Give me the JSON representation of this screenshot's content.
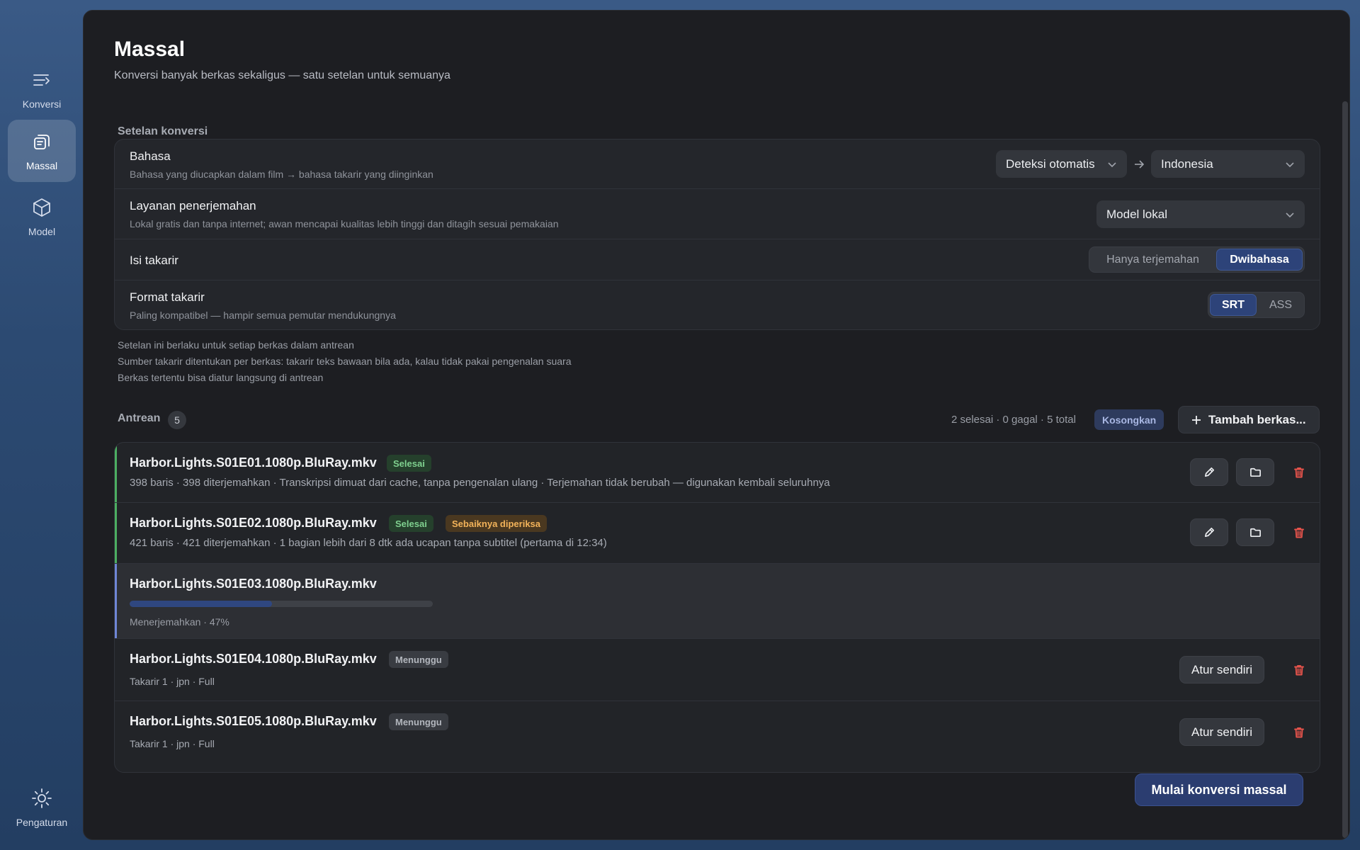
{
  "nav": {
    "items": [
      {
        "label": "Konversi",
        "icon": "convert-icon",
        "active": false
      },
      {
        "label": "Massal",
        "icon": "batch-icon",
        "active": true
      },
      {
        "label": "Model",
        "icon": "cube-icon",
        "active": false
      }
    ],
    "settings_label": "Pengaturan"
  },
  "page": {
    "title": "Massal",
    "subtitle": "Konversi banyak berkas sekaligus — satu setelan untuk semuanya"
  },
  "settings": {
    "section_label": "Setelan konversi",
    "language": {
      "title": "Bahasa",
      "desc": "Bahasa yang diucapkan dalam film → bahasa takarir yang diinginkan",
      "source": "Deteksi otomatis",
      "target": "Indonesia"
    },
    "service": {
      "title": "Layanan penerjemahan",
      "desc": "Lokal gratis dan tanpa internet; awan mencapai kualitas lebih tinggi dan ditagih sesuai pemakaian",
      "value": "Model lokal"
    },
    "content": {
      "title": "Isi takarir",
      "options": [
        "Hanya terjemahan",
        "Dwibahasa"
      ],
      "selected": "Dwibahasa"
    },
    "format": {
      "title": "Format takarir",
      "desc": "Paling kompatibel — hampir semua pemutar mendukungnya",
      "options": [
        "SRT",
        "ASS"
      ],
      "selected": "SRT"
    },
    "notes": [
      "Setelan ini berlaku untuk setiap berkas dalam antrean",
      "Sumber takarir ditentukan per berkas: takarir teks bawaan bila ada, kalau tidak pakai pengenalan suara",
      "Berkas tertentu bisa diatur langsung di antrean"
    ]
  },
  "queue": {
    "label": "Antrean",
    "count": "5",
    "stats": "2 selesai · 0 gagal · 5 total",
    "clear_label": "Kosongkan",
    "add_label": "Tambah berkas...",
    "items": [
      {
        "name": "Harbor.Lights.S01E01.1080p.BluRay.mkv",
        "tags": [
          "Selesai"
        ],
        "detail": "398 baris · 398 diterjemahkan · Transkripsi dimuat dari cache, tanpa pengenalan ulang · Terjemahan tidak berubah — digunakan kembali seluruhnya",
        "status": "done"
      },
      {
        "name": "Harbor.Lights.S01E02.1080p.BluRay.mkv",
        "tags": [
          "Selesai",
          "Sebaiknya diperiksa"
        ],
        "detail": "421 baris · 421 diterjemahkan · 1 bagian lebih dari 8 dtk ada ucapan tanpa subtitel (pertama di 12:34)",
        "status": "done"
      },
      {
        "name": "Harbor.Lights.S01E03.1080p.BluRay.mkv",
        "detail": "Menerjemahkan · 47%",
        "progress": 0.47,
        "status": "running"
      },
      {
        "name": "Harbor.Lights.S01E04.1080p.BluRay.mkv",
        "tags": [
          "Menunggu"
        ],
        "detail": "Takarir 1 · jpn · Full",
        "action": "Atur sendiri",
        "status": "waiting"
      },
      {
        "name": "Harbor.Lights.S01E05.1080p.BluRay.mkv",
        "tags": [
          "Menunggu"
        ],
        "detail": "Takarir 1 · jpn · Full",
        "action": "Atur sendiri",
        "status": "waiting"
      }
    ]
  },
  "start_label": "Mulai konversi massal",
  "colors": {
    "accent": "#2b3d70",
    "done": "#4caf62",
    "running": "#6f86d6",
    "warning": "#f3b35a",
    "danger": "#e5534b"
  }
}
